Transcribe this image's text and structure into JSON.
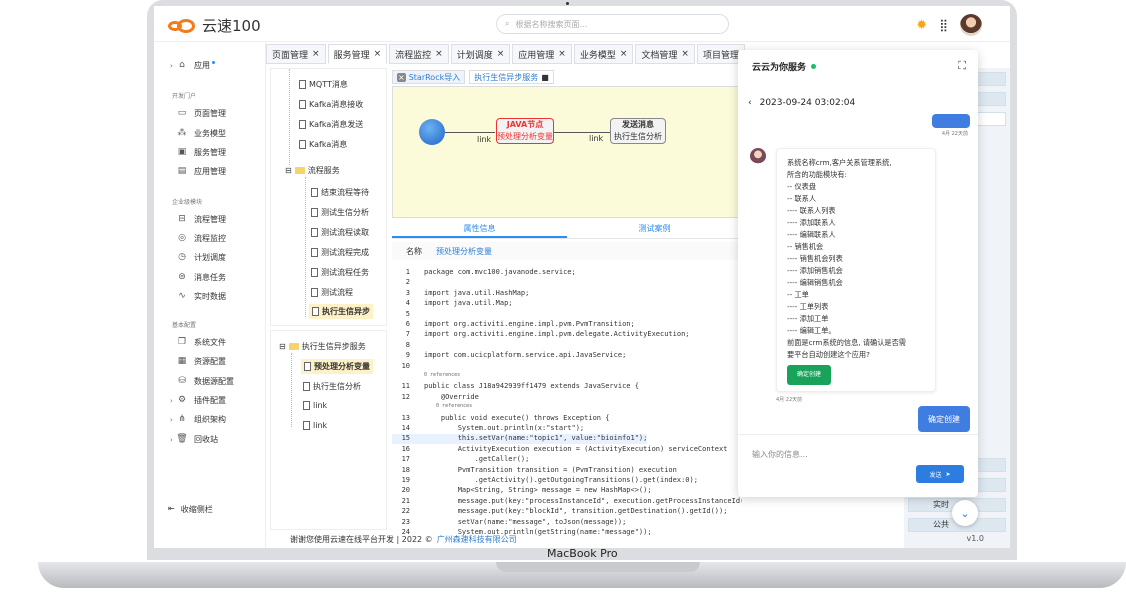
{
  "app": {
    "title": "云速100",
    "search_placeholder": "根据名称搜索页面...",
    "version": "v1.0",
    "device_label": "MacBook Pro"
  },
  "sidebar": {
    "app_item": "应用",
    "group1": "开发门户",
    "dev_items": [
      {
        "label": "页面管理",
        "icon": "page-icon"
      },
      {
        "label": "业务模型",
        "icon": "model-icon"
      },
      {
        "label": "服务管理",
        "icon": "service-icon"
      },
      {
        "label": "应用管理",
        "icon": "app-icon"
      }
    ],
    "group2": "企业级模块",
    "ent_items": [
      {
        "label": "流程管理",
        "icon": "process-icon"
      },
      {
        "label": "流程监控",
        "icon": "monitor-icon"
      },
      {
        "label": "计划调度",
        "icon": "clock-icon"
      },
      {
        "label": "消息任务",
        "icon": "message-icon"
      },
      {
        "label": "实时数据",
        "icon": "realtime-icon"
      }
    ],
    "group3": "基本配置",
    "base_items": [
      {
        "label": "系统文件",
        "icon": "file-icon"
      },
      {
        "label": "资源配置",
        "icon": "resource-icon"
      },
      {
        "label": "数据源配置",
        "icon": "datasource-icon"
      },
      {
        "label": "插件配置",
        "icon": "plugin-icon"
      },
      {
        "label": "组织架构",
        "icon": "org-icon"
      },
      {
        "label": "回收站",
        "icon": "trash-icon"
      }
    ],
    "collapse": "收缩侧栏"
  },
  "tabs": [
    "页面管理",
    "服务管理",
    "流程监控",
    "计划调度",
    "应用管理",
    "业务模型",
    "文档管理",
    "项目管理"
  ],
  "tree1": {
    "items": [
      "MQTT消息",
      "Kafka消息接收",
      "Kafka消息发送",
      "Kafka消息"
    ],
    "folder": "流程服务",
    "children": [
      "结束流程等待",
      "测试生信分析",
      "测试流程读取",
      "测试流程完成",
      "测试流程任务",
      "测试流程",
      "执行生信异步"
    ]
  },
  "tree2": {
    "folder": "执行生信异步服务",
    "children": [
      "预处理分析变量",
      "执行生信分析",
      "link",
      "link"
    ]
  },
  "editor": {
    "tabs": [
      "StarRock导入",
      "执行生信异步服务"
    ],
    "flow": {
      "node1_title": "JAVA节点",
      "node1_sub": "预处理分析变量",
      "node2_title": "发送消息",
      "node2_sub": "执行生信分析",
      "link1": "link",
      "link2": "link"
    },
    "prop_tabs": [
      "属性信息",
      "测试案例"
    ],
    "name_label": "名称",
    "name_value": "预处理分析变量"
  },
  "code": [
    {
      "n": "1",
      "t": "package com.mvc100.javanode.service;"
    },
    {
      "n": "2",
      "t": ""
    },
    {
      "n": "3",
      "t": "import java.util.HashMap;"
    },
    {
      "n": "4",
      "t": "import java.util.Map;"
    },
    {
      "n": "5",
      "t": ""
    },
    {
      "n": "6",
      "t": "import org.activiti.engine.impl.pvm.PvmTransition;"
    },
    {
      "n": "7",
      "t": "import org.activiti.engine.impl.pvm.delegate.ActivityExecution;"
    },
    {
      "n": "8",
      "t": ""
    },
    {
      "n": "9",
      "t": "import com.ucicplatform.service.api.JavaService;"
    },
    {
      "n": "10",
      "t": ""
    },
    {
      "n": "",
      "t": "0 references"
    },
    {
      "n": "11",
      "t": "public class J18a942939ff1479 extends JavaService {"
    },
    {
      "n": "12",
      "t": "    @Override"
    },
    {
      "n": "",
      "t": "    0 references"
    },
    {
      "n": "13",
      "t": "    public void execute() throws Exception {"
    },
    {
      "n": "14",
      "t": "        System.out.println(x:\"start\");"
    },
    {
      "n": "15",
      "t": "        this.setVar(name:\"topic1\", value:\"bioinfo1\");"
    },
    {
      "n": "16",
      "t": "        ActivityExecution execution = (ActivityExecution) serviceContext"
    },
    {
      "n": "17",
      "t": "            .getCaller();"
    },
    {
      "n": "18",
      "t": "        PvmTransition transition = (PvmTransition) execution"
    },
    {
      "n": "19",
      "t": "            .getActivity().getOutgoingTransitions().get(index:0);"
    },
    {
      "n": "20",
      "t": "        Map<String, String> message = new HashMap<>();"
    },
    {
      "n": "21",
      "t": "        message.put(key:\"processInstanceId\", execution.getProcessInstanceId());"
    },
    {
      "n": "22",
      "t": "        message.put(key:\"blockId\", transition.getDestination().getId());"
    },
    {
      "n": "23",
      "t": "        setVar(name:\"message\", toJson(message));"
    },
    {
      "n": "24",
      "t": "        System.out.println(getString(name:\"message\"));"
    }
  ],
  "right_panel": {
    "items": [
      "实时",
      "公共"
    ]
  },
  "footer": {
    "text": "谢谢您使用云速在线平台开发 | 2022 ©",
    "company": "广州森速科技有限公司"
  },
  "chat": {
    "title": "云云为你服务",
    "date": "2023-09-24 03:02:04",
    "ts1": "4月 22天前",
    "ts2": "4月 22天前",
    "message_lines": [
      "系统名称crm,客户关系管理系统,",
      "所含的功能模块有:",
      "-- 仪表盘",
      "-- 联系人",
      "---- 联系人列表",
      "---- 添加联系人",
      "---- 编辑联系人",
      "-- 销售机会",
      "---- 销售机会列表",
      "---- 添加销售机会",
      "---- 编辑销售机会",
      "-- 工单",
      "---- 工单列表",
      "---- 添加工单",
      "---- 编辑工单。",
      "前面是crm系统的信息, 请确认是否需",
      "要平台自动创建这个应用?"
    ],
    "confirm_button": "确定创建",
    "user_reply": "确定创建",
    "input_placeholder": "输入你的信息...",
    "send_button": "发送"
  },
  "colors": {
    "accent": "#2d7de0",
    "brand": "#f27b1a",
    "confirm": "#19a35a"
  }
}
